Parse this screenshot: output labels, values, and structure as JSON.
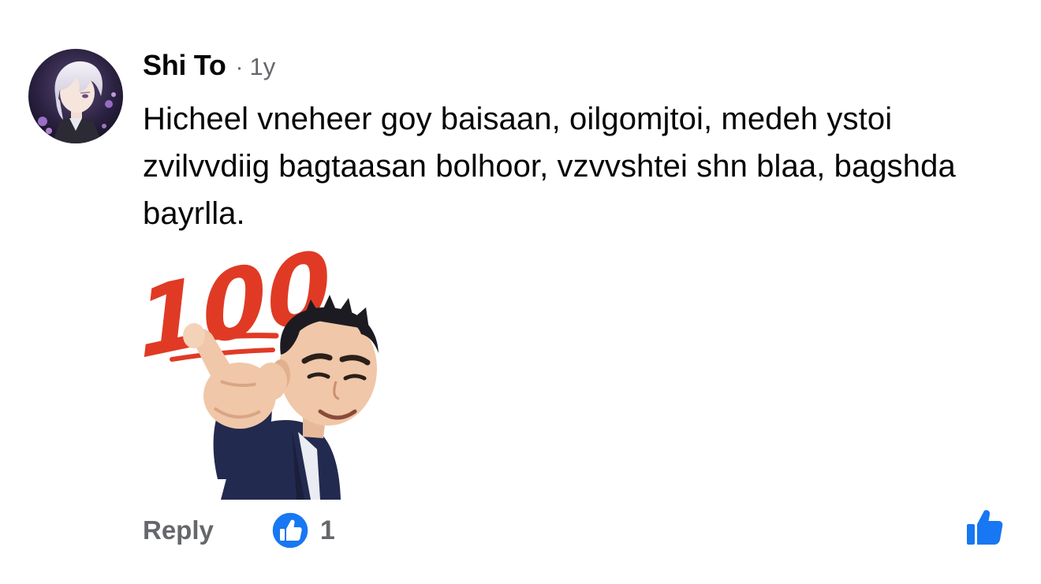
{
  "comment": {
    "author": "Shi To",
    "separator": "·",
    "time": "1y",
    "text": "Hicheel vneheer goy baisaan, oilgomjtoi, medeh ystoi zvilvvdiig bagtaasan bolhoor, vzvvshtei shn blaa, bagshda bayrlla.",
    "sticker_text": "100"
  },
  "actions": {
    "reply_label": "Reply",
    "like_count": "1"
  },
  "colors": {
    "facebook_blue": "#1877f2",
    "secondary_text": "#65676b",
    "primary_text": "#050505",
    "hundred_red": "#e03a25"
  },
  "icons": {
    "avatar": "anime-avatar",
    "reaction": "like-reaction-icon",
    "like": "thumbs-up-icon"
  }
}
